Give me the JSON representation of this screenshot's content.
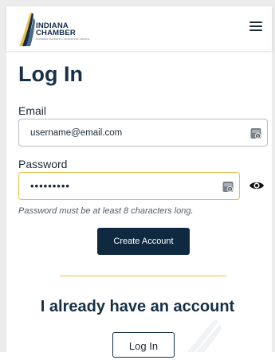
{
  "header": {
    "logo_line1": "INDIANA",
    "logo_line2": "CHAMBER",
    "logo_tagline": "CHAMBER BUSINESS • ADVANCING INDIANA",
    "menu_icon": "hamburger-icon"
  },
  "form": {
    "title": "Log In",
    "email_label": "Email",
    "email_value": "username@email.com",
    "password_label": "Password",
    "password_value": "•••••••••",
    "password_hint": "Password must be at least 8 characters long.",
    "create_account_label": "Create Account"
  },
  "existing": {
    "heading": "I already have an account",
    "login_label": "Log In"
  },
  "colors": {
    "navy": "#0f2a40",
    "accent_gold": "#e8c04b",
    "text": "#1b2a38"
  },
  "icons": {
    "password_manager": "password-manager-icon",
    "show_password": "eye-icon"
  }
}
